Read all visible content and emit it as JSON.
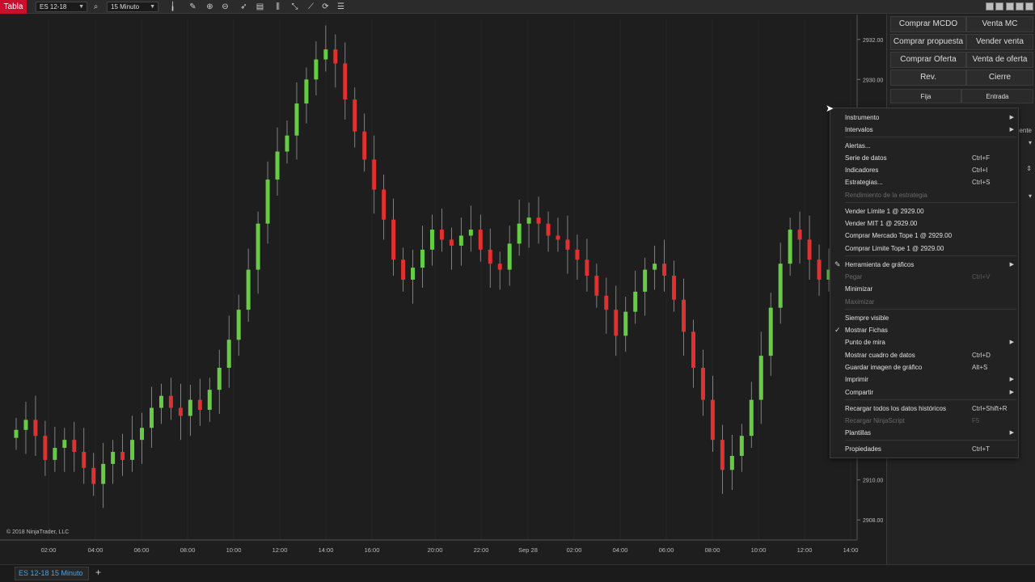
{
  "toolbar": {
    "app_title": "Tabla",
    "instrument": "ES 12-18",
    "interval": "15 Minuto",
    "icons": [
      "search-icon",
      "bar-type-icon",
      "pencil-icon",
      "zoom-in-icon",
      "zoom-out-icon",
      "pointer-icon",
      "properties-icon",
      "split-icon",
      "scale-icon",
      "drawing-tools-icon",
      "reload-icon",
      "list-icon"
    ]
  },
  "chart": {
    "copyright": "© 2018 NinjaTrader, LLC",
    "x_ticks": [
      "02:00",
      "04:00",
      "06:00",
      "08:00",
      "10:00",
      "12:00",
      "14:00",
      "16:00",
      "20:00",
      "22:00",
      "Sep 28",
      "02:00",
      "04:00",
      "06:00",
      "08:00",
      "10:00",
      "12:00",
      "14:00"
    ],
    "y_ticks": [
      "2932.00",
      "2930.00",
      "2910.00",
      "2908.00"
    ],
    "up_color": "#66cc44",
    "down_color": "#e03030"
  },
  "chart_data": {
    "type": "candlestick",
    "title": "",
    "instrument": "ES 12-18",
    "interval": "15 Minuto",
    "ylabel": "",
    "ylim": [
      2907,
      2933
    ],
    "closes": [
      2912.5,
      2913.0,
      2912.2,
      2911.0,
      2911.6,
      2912.0,
      2911.4,
      2910.6,
      2909.8,
      2910.8,
      2911.4,
      2911.0,
      2912.0,
      2912.6,
      2913.6,
      2914.2,
      2913.6,
      2913.2,
      2914.0,
      2913.5,
      2914.5,
      2915.6,
      2917.0,
      2918.5,
      2920.5,
      2922.8,
      2925.0,
      2926.4,
      2927.2,
      2928.8,
      2930.0,
      2931.0,
      2931.5,
      2930.8,
      2929.0,
      2927.4,
      2926.0,
      2924.5,
      2923.0,
      2921.0,
      2920.0,
      2920.6,
      2921.5,
      2922.5,
      2922.0,
      2921.7,
      2922.2,
      2922.5,
      2921.5,
      2920.8,
      2920.5,
      2921.8,
      2922.8,
      2923.1,
      2922.8,
      2922.2,
      2922.0,
      2921.5,
      2921.0,
      2920.2,
      2919.2,
      2918.5,
      2917.2,
      2918.4,
      2919.4,
      2920.5,
      2920.8,
      2920.2,
      2919.0,
      2917.4,
      2915.6,
      2914.0,
      2912.0,
      2910.5,
      2911.2,
      2912.2,
      2914.0,
      2916.2,
      2918.6,
      2920.8,
      2922.5,
      2922.0,
      2921.0,
      2920.0,
      2920.5
    ]
  },
  "trader": {
    "buttons": [
      [
        "Comprar MCDO",
        "Venta MC"
      ],
      [
        "Comprar propuesta",
        "Vender venta"
      ],
      [
        "Comprar Oferta",
        "Venta de oferta"
      ],
      [
        "Rev.",
        "Cierre"
      ]
    ],
    "tabs": [
      "Fija",
      "Entrada"
    ],
    "partial_label": "ente"
  },
  "context_menu": {
    "items": [
      {
        "label": "Instrumento",
        "shortcut": "",
        "submenu": true,
        "disabled": false,
        "checked": false
      },
      {
        "label": "Intervalos",
        "shortcut": "",
        "submenu": true,
        "disabled": false,
        "checked": false
      },
      {
        "label": "Alertas...",
        "shortcut": "",
        "submenu": false,
        "disabled": false,
        "checked": false
      },
      {
        "label": "Serie de datos",
        "shortcut": "Ctrl+F",
        "submenu": false,
        "disabled": false,
        "checked": false
      },
      {
        "label": "Indicadores",
        "shortcut": "Ctrl+I",
        "submenu": false,
        "disabled": false,
        "checked": false
      },
      {
        "label": "Estrategias...",
        "shortcut": "Ctrl+S",
        "submenu": false,
        "disabled": false,
        "checked": false
      },
      {
        "label": "Rendimiento de la estrategia",
        "shortcut": "",
        "submenu": false,
        "disabled": true,
        "checked": false
      },
      {
        "label": "Vender Límite 1 @ 2929.00",
        "shortcut": "",
        "submenu": false,
        "disabled": false,
        "checked": false
      },
      {
        "label": "Vender MIT 1 @ 2929.00",
        "shortcut": "",
        "submenu": false,
        "disabled": false,
        "checked": false
      },
      {
        "label": "Comprar Mercado Tope 1 @ 2929.00",
        "shortcut": "",
        "submenu": false,
        "disabled": false,
        "checked": false
      },
      {
        "label": "Comprar Limite Tope 1 @ 2929.00",
        "shortcut": "",
        "submenu": false,
        "disabled": false,
        "checked": false
      },
      {
        "label": "Herramienta de gráficos",
        "shortcut": "",
        "submenu": true,
        "disabled": false,
        "checked": false,
        "icon": "pencil-icon"
      },
      {
        "label": "Pegar",
        "shortcut": "Ctrl+V",
        "submenu": false,
        "disabled": true,
        "checked": false
      },
      {
        "label": "Minimizar",
        "shortcut": "",
        "submenu": false,
        "disabled": false,
        "checked": false
      },
      {
        "label": "Maximizar",
        "shortcut": "",
        "submenu": false,
        "disabled": true,
        "checked": false
      },
      {
        "label": "Siempre visible",
        "shortcut": "",
        "submenu": false,
        "disabled": false,
        "checked": false
      },
      {
        "label": "Mostrar Fichas",
        "shortcut": "",
        "submenu": false,
        "disabled": false,
        "checked": true
      },
      {
        "label": "Punto de mira",
        "shortcut": "",
        "submenu": true,
        "disabled": false,
        "checked": false
      },
      {
        "label": "Mostrar cuadro de datos",
        "shortcut": "Ctrl+D",
        "submenu": false,
        "disabled": false,
        "checked": false
      },
      {
        "label": "Guardar imagen de gráfico",
        "shortcut": "Alt+S",
        "submenu": false,
        "disabled": false,
        "checked": false
      },
      {
        "label": "Imprimir",
        "shortcut": "",
        "submenu": true,
        "disabled": false,
        "checked": false
      },
      {
        "label": "Compartir",
        "shortcut": "",
        "submenu": true,
        "disabled": false,
        "checked": false
      },
      {
        "label": "Recargar todos los datos históricos",
        "shortcut": "Ctrl+Shift+R",
        "submenu": false,
        "disabled": false,
        "checked": false
      },
      {
        "label": "Recargar NinjaScript",
        "shortcut": "F5",
        "submenu": false,
        "disabled": true,
        "checked": false
      },
      {
        "label": "Plantillas",
        "shortcut": "",
        "submenu": true,
        "disabled": false,
        "checked": false
      },
      {
        "label": "Propiedades",
        "shortcut": "Ctrl+T",
        "submenu": false,
        "disabled": false,
        "checked": false
      }
    ]
  },
  "bottom": {
    "tab_label": "ES 12-18 15 Minuto",
    "add_tab": "+"
  }
}
